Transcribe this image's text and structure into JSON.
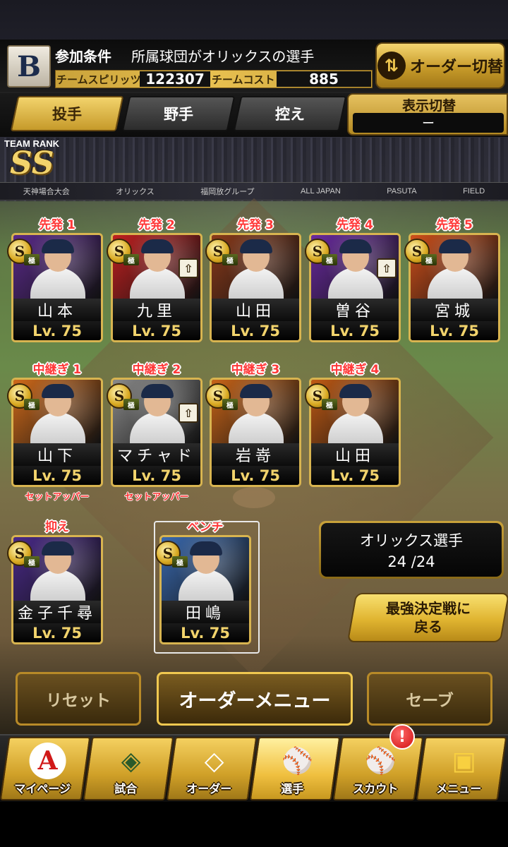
{
  "header": {
    "team_logo": "B",
    "condition_label": "参加条件",
    "condition_value": "所属球団がオリックスの選手",
    "spirit_label": "チームスピリッツ",
    "spirit_value": "122307",
    "cost_label": "チームコスト",
    "cost_value": "885",
    "order_switch_label": "オーダー切替",
    "order_switch_icon": "swap-arrows-icon"
  },
  "tabs": [
    {
      "label": "投手",
      "active": true
    },
    {
      "label": "野手",
      "active": false
    },
    {
      "label": "控え",
      "active": false
    }
  ],
  "display_switch": {
    "label": "表示切替",
    "value": "ー"
  },
  "team_rank": {
    "label": "TEAM RANK",
    "value": "SS"
  },
  "stadium_ads": [
    "天神場合大会",
    "オリックス",
    "福岡放グループ",
    "ALL JAPAN",
    "PASUTA",
    "FIELD"
  ],
  "starters": [
    {
      "slot": "先発 1",
      "name": "山本",
      "level": "Lv. 75",
      "bg": "#5a2a8a",
      "upgrade": false
    },
    {
      "slot": "先発 2",
      "name": "九里",
      "level": "Lv. 75",
      "bg": "#c02020",
      "upgrade": true
    },
    {
      "slot": "先発 3",
      "name": "山田",
      "level": "Lv. 75",
      "bg": "#8a3a1a",
      "upgrade": false
    },
    {
      "slot": "先発 4",
      "name": "曽谷",
      "level": "Lv. 75",
      "bg": "#6a2aa0",
      "upgrade": true
    },
    {
      "slot": "先発 5",
      "name": "宮城",
      "level": "Lv. 75",
      "bg": "#d0501a",
      "upgrade": false
    }
  ],
  "relievers": [
    {
      "slot": "中継ぎ 1",
      "name": "山下",
      "level": "Lv. 75",
      "role": "セットアッパー",
      "bg": "#d06a1a",
      "upgrade": false
    },
    {
      "slot": "中継ぎ 2",
      "name": "マチャド",
      "level": "Lv. 75",
      "role": "セットアッパー",
      "bg": "#8a8a8a",
      "upgrade": true
    },
    {
      "slot": "中継ぎ 3",
      "name": "岩嵜",
      "level": "Lv. 75",
      "role": "",
      "bg": "#c86418",
      "upgrade": false
    },
    {
      "slot": "中継ぎ 4",
      "name": "山田",
      "level": "Lv. 75",
      "role": "",
      "bg": "#c05a14",
      "upgrade": false
    }
  ],
  "closer": {
    "slot": "抑え",
    "name": "金子千尋",
    "level": "Lv. 75",
    "bg": "#4a2a8a"
  },
  "bench": {
    "slot": "ベンチ",
    "name": "田嶋",
    "level": "Lv. 75",
    "bg": "#3a6ab0"
  },
  "orix_players": {
    "label": "オリックス選手",
    "count": "24 /24"
  },
  "back_button": "最強決定戦に\n戻る",
  "buttons": {
    "reset": "リセット",
    "order_menu": "オーダーメニュー",
    "save": "セーブ"
  },
  "nav": [
    {
      "label": "マイページ",
      "icon": "a-logo-icon"
    },
    {
      "label": "試合",
      "icon": "stadium-icon"
    },
    {
      "label": "オーダー",
      "icon": "field-order-icon"
    },
    {
      "label": "選手",
      "icon": "player-silhouette-icon"
    },
    {
      "label": "スカウト",
      "icon": "bat-scout-icon"
    },
    {
      "label": "メニュー",
      "icon": "mascot-menu-icon"
    }
  ],
  "notification_badge": "!",
  "card_badge": {
    "grade": "S",
    "tier": "極"
  }
}
